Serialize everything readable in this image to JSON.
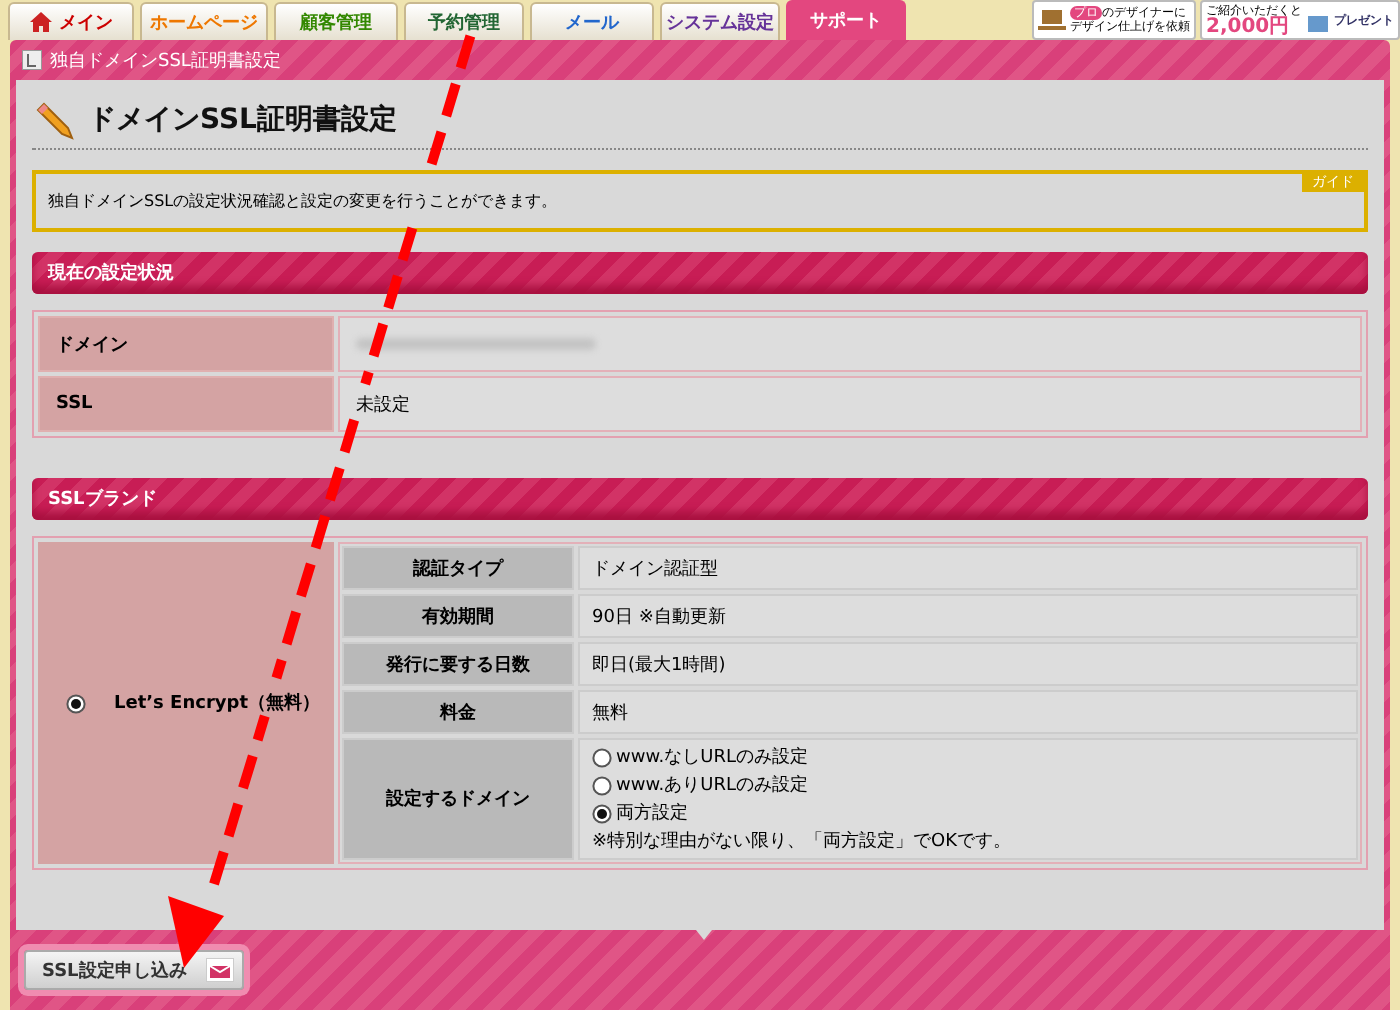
{
  "tabs": [
    {
      "label": "メイン",
      "kind": "home",
      "color": "#cc0000",
      "selected": false
    },
    {
      "label": "ホームページ",
      "kind": "plain",
      "color": "#ee7700",
      "selected": false
    },
    {
      "label": "顧客管理",
      "kind": "plain",
      "color": "#338800",
      "selected": false
    },
    {
      "label": "予約管理",
      "kind": "plain",
      "color": "#226633",
      "selected": false
    },
    {
      "label": "メール",
      "kind": "plain",
      "color": "#2266cc",
      "selected": false
    },
    {
      "label": "システム設定",
      "kind": "plain",
      "color": "#663399",
      "selected": false
    },
    {
      "label": "サポート",
      "kind": "plain",
      "color": "#ffffff",
      "selected": true
    }
  ],
  "ads": [
    {
      "kind": "designer",
      "badge": "プロ",
      "lines": [
        "のデザイナーに",
        "デザイン仕上げを依頼"
      ]
    },
    {
      "kind": "referral",
      "lines": [
        "ご紹介いただくと",
        "2,000円",
        "プレゼント"
      ]
    }
  ],
  "breadcrumb": "独自ドメインSSL証明書設定",
  "page_title": "ドメインSSL証明書設定",
  "guide": {
    "text": "独自ドメインSSLの設定状況確認と設定の変更を行うことができます。",
    "badge": "ガイド"
  },
  "current_status": {
    "heading": "現在の設定状況",
    "rows": [
      {
        "label": "ドメイン",
        "kind": "blurred"
      },
      {
        "label": "SSL",
        "kind": "text",
        "value": "未設定"
      }
    ]
  },
  "ssl_brand": {
    "heading": "SSLブランド",
    "brands": [
      {
        "name": "Let’s Encrypt（無料）",
        "selected": true,
        "details": [
          {
            "label": "認証タイプ",
            "kind": "text",
            "value": "ドメイン認証型"
          },
          {
            "label": "有効期間",
            "kind": "text",
            "value": "90日 ※自動更新"
          },
          {
            "label": "発行に要する日数",
            "kind": "text",
            "value": "即日(最大1時間)"
          },
          {
            "label": "料金",
            "kind": "text",
            "value": "無料"
          },
          {
            "label": "設定するドメイン",
            "kind": "options",
            "options": [
              {
                "label": "www.なしURLのみ設定",
                "selected": false
              },
              {
                "label": "www.ありURLのみ設定",
                "selected": false
              },
              {
                "label": "両方設定",
                "selected": true
              }
            ],
            "note": "※特別な理由がない限り、「両方設定」でOKです。"
          }
        ]
      }
    ]
  },
  "submit_button": "SSL設定申し込み"
}
